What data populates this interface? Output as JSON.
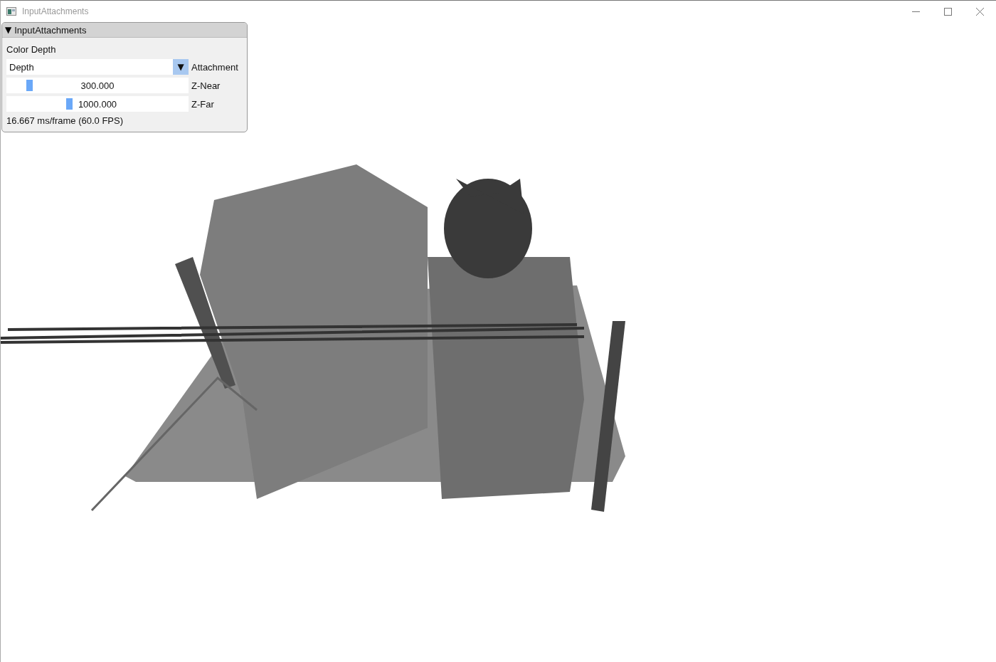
{
  "window": {
    "title": "InputAttachments"
  },
  "panel": {
    "collapse_glyph": "▼",
    "title": "InputAttachments",
    "expanded": true,
    "section_label": "Color Depth",
    "dropdown": {
      "value": "Depth",
      "arrow": "▼",
      "label": "Attachment"
    },
    "sliders": [
      {
        "reading": "300.000",
        "level": 0.12,
        "label": "Z-Near"
      },
      {
        "reading": "1000.000",
        "level": 0.34,
        "label": "Z-Far"
      }
    ],
    "stats": "16.667 ms/frame (60.0 FPS)"
  }
}
